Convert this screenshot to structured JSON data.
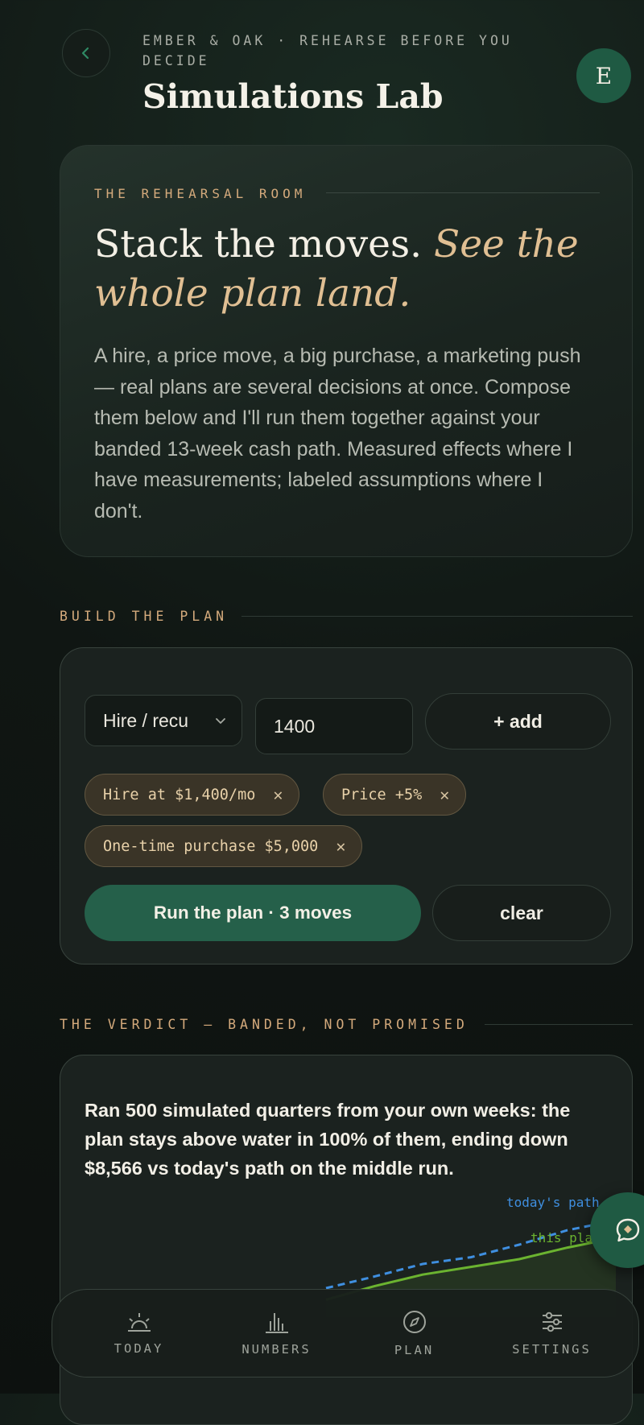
{
  "header": {
    "eyebrow": "EMBER & OAK · REHEARSE BEFORE YOU DECIDE",
    "title": "Simulations Lab",
    "avatar_initial": "E"
  },
  "hero": {
    "kicker": "THE REHEARSAL ROOM",
    "headline_plain": "Stack the moves. ",
    "headline_italic": "See the whole plan land.",
    "body": "A hire, a price move, a big purchase, a marketing push — real plans are several decisions at once. Compose them below and I'll run them together against your banded 13-week cash path. Measured effects where I have measurements; labeled assumptions where I don't."
  },
  "builder": {
    "section_label": "BUILD THE PLAN",
    "select_value": "Hire / recu",
    "amount_value": "1400",
    "add_label": "+ add",
    "chips": [
      {
        "label": "Hire at $1,400/mo"
      },
      {
        "label": "Price +5%"
      },
      {
        "label": "One-time purchase $5,000"
      }
    ],
    "run_label": "Run the plan · 3 moves",
    "clear_label": "clear"
  },
  "verdict": {
    "section_label": "THE VERDICT — BANDED, NOT PROMISED",
    "text": "Ran 500 simulated quarters from your own weeks: the plan stays above water in 100% of them, ending down $8,566 vs today's path on the middle run."
  },
  "chart_data": {
    "type": "line",
    "series": [
      {
        "name": "today's path",
        "values": [
          0.3,
          0.42,
          0.55,
          0.62,
          0.75,
          0.9,
          1.0
        ],
        "color": "#3f8fe0",
        "style": "dashed"
      },
      {
        "name": "this plan",
        "values": [
          0.18,
          0.32,
          0.44,
          0.52,
          0.6,
          0.72,
          0.82
        ],
        "color": "#6bb330",
        "style": "solid"
      }
    ]
  },
  "nav": [
    {
      "label": "TODAY",
      "icon": "sunrise-icon"
    },
    {
      "label": "NUMBERS",
      "icon": "bar-chart-icon"
    },
    {
      "label": "PLAN",
      "icon": "compass-icon"
    },
    {
      "label": "SETTINGS",
      "icon": "sliders-icon"
    }
  ],
  "colors": {
    "accent_green": "#25604a",
    "gold": "#d4aa7c",
    "background": "#101613"
  }
}
